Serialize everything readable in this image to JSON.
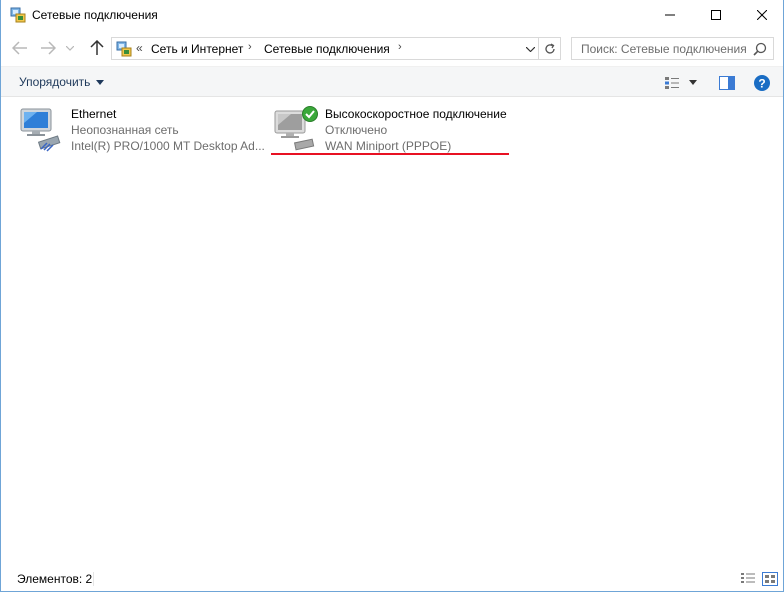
{
  "window": {
    "title": "Сетевые подключения"
  },
  "address": {
    "overflow": "«",
    "crumbs": [
      "Сеть и Интернет",
      "Сетевые подключения"
    ],
    "search_placeholder": "Поиск: Сетевые подключения"
  },
  "toolbar": {
    "organize_label": "Упорядочить"
  },
  "connections": [
    {
      "name": "Ethernet",
      "status": "Неопознанная сеть",
      "device": "Intel(R) PRO/1000 MT Desktop Ad...",
      "icon": "ethernet-adapter-icon"
    },
    {
      "name": "Высокоскоростное подключение",
      "status": "Отключено",
      "device": "WAN Miniport (PPPOE)",
      "icon": "pppoe-connection-icon"
    }
  ],
  "statusbar": {
    "count_label": "Элементов: 2"
  },
  "colors": {
    "accent": "#1e395b",
    "highlight_line": "#e81123",
    "help_blue": "#1a6dc4"
  }
}
